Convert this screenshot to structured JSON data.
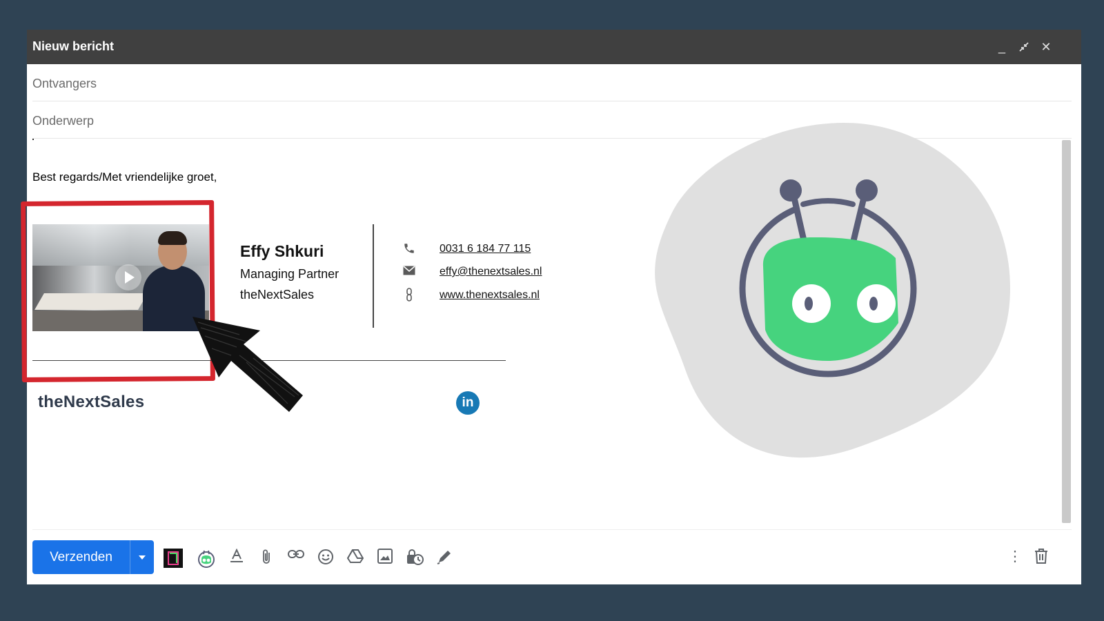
{
  "window": {
    "title": "Nieuw bericht",
    "minimize_icon": "minimize-icon",
    "expand_icon": "exit-fullscreen-icon",
    "close_icon": "close-icon"
  },
  "compose": {
    "recipients_placeholder": "Ontvangers",
    "subject_placeholder": "Onderwerp",
    "greeting": "Best regards/Met vriendelijke groet,"
  },
  "signature": {
    "name": "Effy Shkuri",
    "role": "Managing Partner",
    "company": "theNextSales",
    "phone": "0031 6 184 77 115",
    "email": "effy@thenextsales.nl",
    "website": "www.thenextsales.nl",
    "logo": "theNextSales",
    "linkedin": "in",
    "accent_red": "#d4262e"
  },
  "footer": {
    "send_label": "Verzenden",
    "send_color": "#1a73e8"
  },
  "colors": {
    "background": "#2f4354",
    "titlebar": "#404040",
    "mascot_green": "#46d37e",
    "mascot_ring": "#5a5e78",
    "blob_gray": "#e0e0e0"
  }
}
